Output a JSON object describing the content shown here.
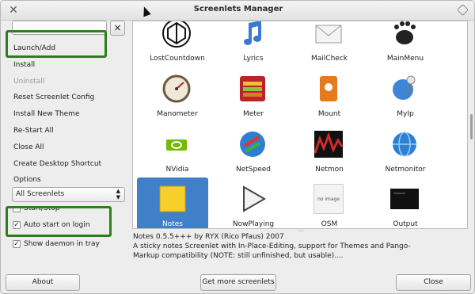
{
  "window": {
    "title": "Screenlets Manager"
  },
  "search": {
    "value": "",
    "clear_label": "×"
  },
  "menu": [
    {
      "label": "Launch/Add",
      "enabled": true
    },
    {
      "label": "Install",
      "enabled": true
    },
    {
      "label": "Uninstall",
      "enabled": false
    },
    {
      "label": "Reset Screenlet Config",
      "enabled": true
    },
    {
      "label": "Install New Theme",
      "enabled": true
    },
    {
      "label": "Re-Start All",
      "enabled": true
    },
    {
      "label": "Close All",
      "enabled": true
    },
    {
      "label": "Create Desktop Shortcut",
      "enabled": true
    },
    {
      "label": "Options",
      "enabled": true
    }
  ],
  "filter": {
    "selected": "All Screenlets"
  },
  "checks": [
    {
      "label": "Start/Stop",
      "checked": false
    },
    {
      "label": "Auto start on login",
      "checked": true
    },
    {
      "label": "Show daemon in tray",
      "checked": true
    }
  ],
  "screenlets": [
    {
      "label": "LostCountdown",
      "icon": "lost-icon"
    },
    {
      "label": "Lyrics",
      "icon": "music-note-icon"
    },
    {
      "label": "MailCheck",
      "icon": "envelope-icon"
    },
    {
      "label": "MainMenu",
      "icon": "gnome-foot-icon"
    },
    {
      "label": "Manometer",
      "icon": "gauge-icon"
    },
    {
      "label": "Meter",
      "icon": "meter-icon"
    },
    {
      "label": "Mount",
      "icon": "drive-icon"
    },
    {
      "label": "MyIp",
      "icon": "globe-pin-icon"
    },
    {
      "label": "NVidia",
      "icon": "nvidia-icon"
    },
    {
      "label": "NetSpeed",
      "icon": "globe-arrows-icon"
    },
    {
      "label": "Netmon",
      "icon": "netmon-graph-icon"
    },
    {
      "label": "Netmonitor",
      "icon": "globe-icon"
    },
    {
      "label": "Notes",
      "icon": "sticky-note-icon",
      "selected": true
    },
    {
      "label": "NowPlaying",
      "icon": "play-icon"
    },
    {
      "label": "OSM",
      "icon": "no-image-icon",
      "image_text": "no image"
    },
    {
      "label": "Output",
      "icon": "terminal-icon"
    }
  ],
  "description": {
    "line1": "Notes 0.5.5+++ by RYX (Rico Pfaus) 2007",
    "line2": "A sticky notes Screenlet with In-Place-Editing, support for Themes and  Pango-",
    "line3": "Markup compatibility (NOTE: still unfinished, but usable)...."
  },
  "buttons": {
    "about": "About",
    "more": "Get more screenlets",
    "close": "Close"
  },
  "colors": {
    "highlight": "#2d7f1e",
    "selection": "#3f80c8"
  }
}
